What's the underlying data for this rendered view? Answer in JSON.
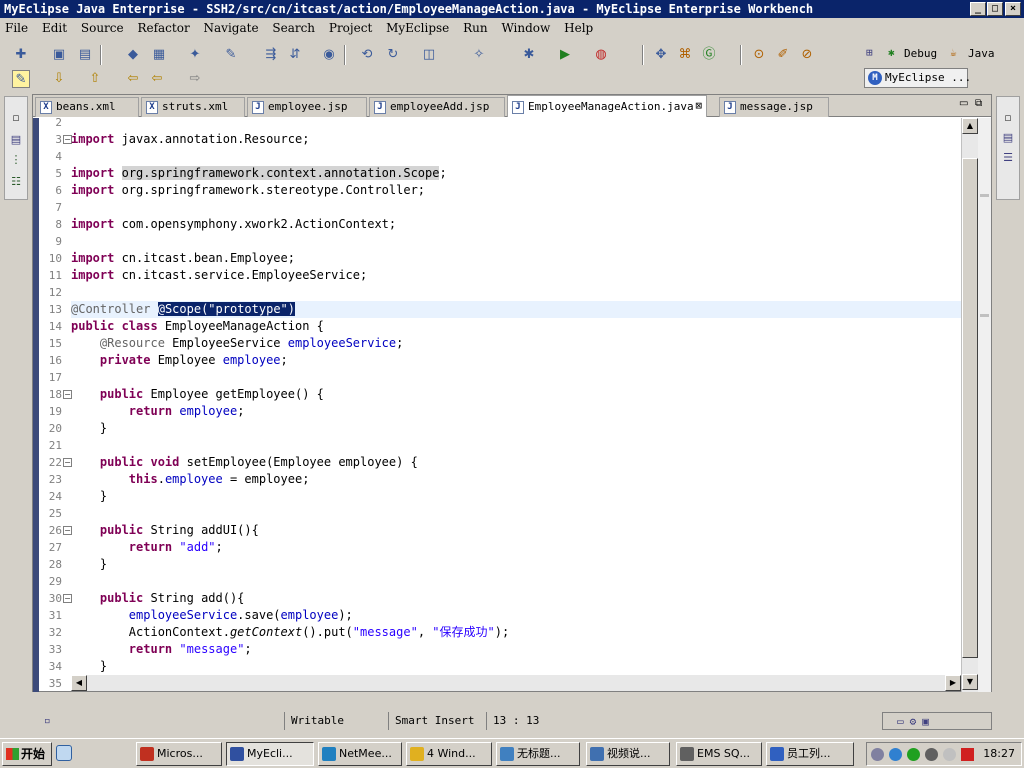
{
  "window": {
    "title": "MyEclipse Java Enterprise - SSH2/src/cn/itcast/action/EmployeeManageAction.java - MyEclipse Enterprise Workbench",
    "minimize": "_",
    "maximize": "□",
    "close": "×"
  },
  "menu": [
    "File",
    "Edit",
    "Source",
    "Refactor",
    "Navigate",
    "Search",
    "Project",
    "MyEclipse",
    "Run",
    "Window",
    "Help"
  ],
  "perspectives": {
    "debug": "Debug",
    "java": "Java",
    "myeclipse": "MyEclipse ..."
  },
  "tabs": [
    {
      "label": "beans.xml",
      "icon": "X"
    },
    {
      "label": "struts.xml",
      "icon": "X"
    },
    {
      "label": "employee.jsp",
      "icon": "J"
    },
    {
      "label": "employeeAdd.jsp",
      "icon": "J"
    },
    {
      "label": "EmployeeManageAction.java",
      "icon": "J",
      "active": true
    },
    {
      "label": "message.jsp",
      "icon": "J"
    }
  ],
  "code_lines": [
    {
      "n": "2",
      "html": ""
    },
    {
      "n": "3",
      "fold": "−",
      "html": "<span class=\"kw\">import</span> javax.annotation.Resource;"
    },
    {
      "n": "4",
      "html": ""
    },
    {
      "n": "5",
      "html": "<span class=\"kw\">import</span> <span class=\"hl\">org.springframework.context.annotation.Scope</span>;"
    },
    {
      "n": "6",
      "html": "<span class=\"kw\">import</span> org.springframework.stereotype.Controller;"
    },
    {
      "n": "7",
      "html": ""
    },
    {
      "n": "8",
      "html": "<span class=\"kw\">import</span> com.opensymphony.xwork2.ActionContext;"
    },
    {
      "n": "9",
      "html": ""
    },
    {
      "n": "10",
      "html": "<span class=\"kw\">import</span> cn.itcast.bean.Employee;"
    },
    {
      "n": "11",
      "html": "<span class=\"kw\">import</span> cn.itcast.service.EmployeeService;"
    },
    {
      "n": "12",
      "html": ""
    },
    {
      "n": "13",
      "current": true,
      "html": "<span class=\"ann\">@Controller</span> <span class=\"sel\">@Scope(\"prototype\")</span>"
    },
    {
      "n": "14",
      "html": "<span class=\"kw\">public class</span> EmployeeManageAction {"
    },
    {
      "n": "15",
      "html": "    <span class=\"ann\">@Resource</span> EmployeeService <span class=\"fld\">employeeService</span>;"
    },
    {
      "n": "16",
      "html": "    <span class=\"kw\">private</span> Employee <span class=\"fld\">employee</span>;"
    },
    {
      "n": "17",
      "html": ""
    },
    {
      "n": "18",
      "fold": "−",
      "html": "    <span class=\"kw\">public</span> Employee getEmployee() {"
    },
    {
      "n": "19",
      "html": "        <span class=\"kw\">return</span> <span class=\"fld\">employee</span>;"
    },
    {
      "n": "20",
      "html": "    }"
    },
    {
      "n": "21",
      "html": ""
    },
    {
      "n": "22",
      "fold": "−",
      "html": "    <span class=\"kw\">public void</span> setEmployee(Employee employee) {"
    },
    {
      "n": "23",
      "html": "        <span class=\"kw\">this</span>.<span class=\"fld\">employee</span> = employee;"
    },
    {
      "n": "24",
      "html": "    }"
    },
    {
      "n": "25",
      "html": ""
    },
    {
      "n": "26",
      "fold": "−",
      "html": "    <span class=\"kw\">public</span> String addUI(){"
    },
    {
      "n": "27",
      "html": "        <span class=\"kw\">return</span> <span class=\"str\">\"add\"</span>;"
    },
    {
      "n": "28",
      "html": "    }"
    },
    {
      "n": "29",
      "html": ""
    },
    {
      "n": "30",
      "fold": "−",
      "html": "    <span class=\"kw\">public</span> String add(){"
    },
    {
      "n": "31",
      "html": "        <span class=\"fld\">employeeService</span>.save(<span class=\"fld\">employee</span>);"
    },
    {
      "n": "32",
      "html": "        ActionContext.<span class=\"it\">getContext</span>().put(<span class=\"str\">\"message\"</span>, <span class=\"str\">\"保存成功\"</span>);"
    },
    {
      "n": "33",
      "html": "        <span class=\"kw\">return</span> <span class=\"str\">\"message\"</span>;"
    },
    {
      "n": "34",
      "html": "    }"
    },
    {
      "n": "35",
      "html": "}"
    }
  ],
  "status": {
    "writable": "Writable",
    "insert_mode": "Smart Insert",
    "position": "13 : 13"
  },
  "taskbar": {
    "start": "开始",
    "tasks": [
      {
        "label": "Micros...",
        "color": "#c03020"
      },
      {
        "label": "MyEcli...",
        "color": "#3050a0",
        "active": true
      },
      {
        "label": "NetMee...",
        "color": "#2080c0"
      },
      {
        "label": "4 Wind...",
        "color": "#e0b020"
      },
      {
        "label": "无标题...",
        "color": "#4080c0"
      },
      {
        "label": "视频说...",
        "color": "#4070b0"
      },
      {
        "label": "EMS SQ...",
        "color": "#606060"
      },
      {
        "label": "员工列...",
        "color": "#3060c0"
      }
    ],
    "clock": "18:27"
  }
}
